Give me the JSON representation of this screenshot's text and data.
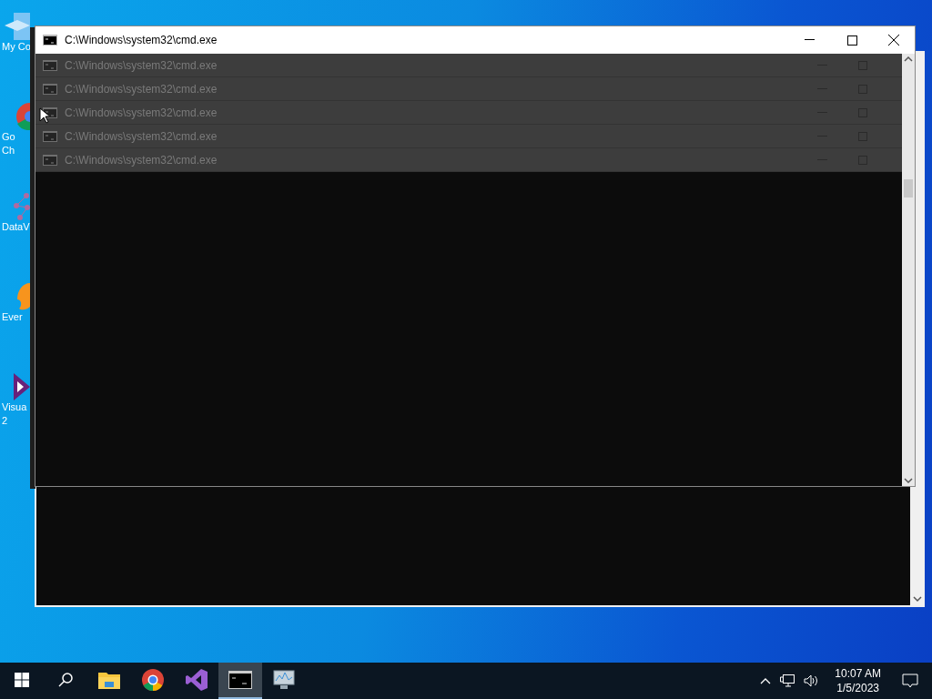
{
  "desktop_icons": [
    {
      "kind": "pc",
      "lines": [
        "My Co"
      ]
    },
    {
      "kind": "chrome",
      "lines": [
        "Go",
        "Ch"
      ]
    },
    {
      "kind": "data",
      "lines": [
        "DataV"
      ]
    },
    {
      "kind": "ever",
      "lines": [
        "Ever"
      ]
    },
    {
      "kind": "vs",
      "lines": [
        "Visua",
        "2"
      ]
    }
  ],
  "window": {
    "title": "C:\\Windows\\system32\\cmd.exe"
  },
  "ghost_title_bars": [
    "C:\\Windows\\system32\\cmd.exe",
    "C:\\Windows\\system32\\cmd.exe",
    "C:\\Windows\\system32\\cmd.exe",
    "C:\\Windows\\system32\\cmd.exe",
    "C:\\Windows\\system32\\cmd.exe"
  ],
  "taskbar": {
    "apps": [
      {
        "kind": "start",
        "selected": false
      },
      {
        "kind": "search",
        "selected": false
      },
      {
        "kind": "folder",
        "selected": false
      },
      {
        "kind": "chrome",
        "selected": false
      },
      {
        "kind": "vs",
        "selected": false
      },
      {
        "kind": "cmd",
        "selected": true
      },
      {
        "kind": "monitor",
        "selected": false
      }
    ],
    "time": "10:07 AM",
    "date": "1/5/2023"
  }
}
